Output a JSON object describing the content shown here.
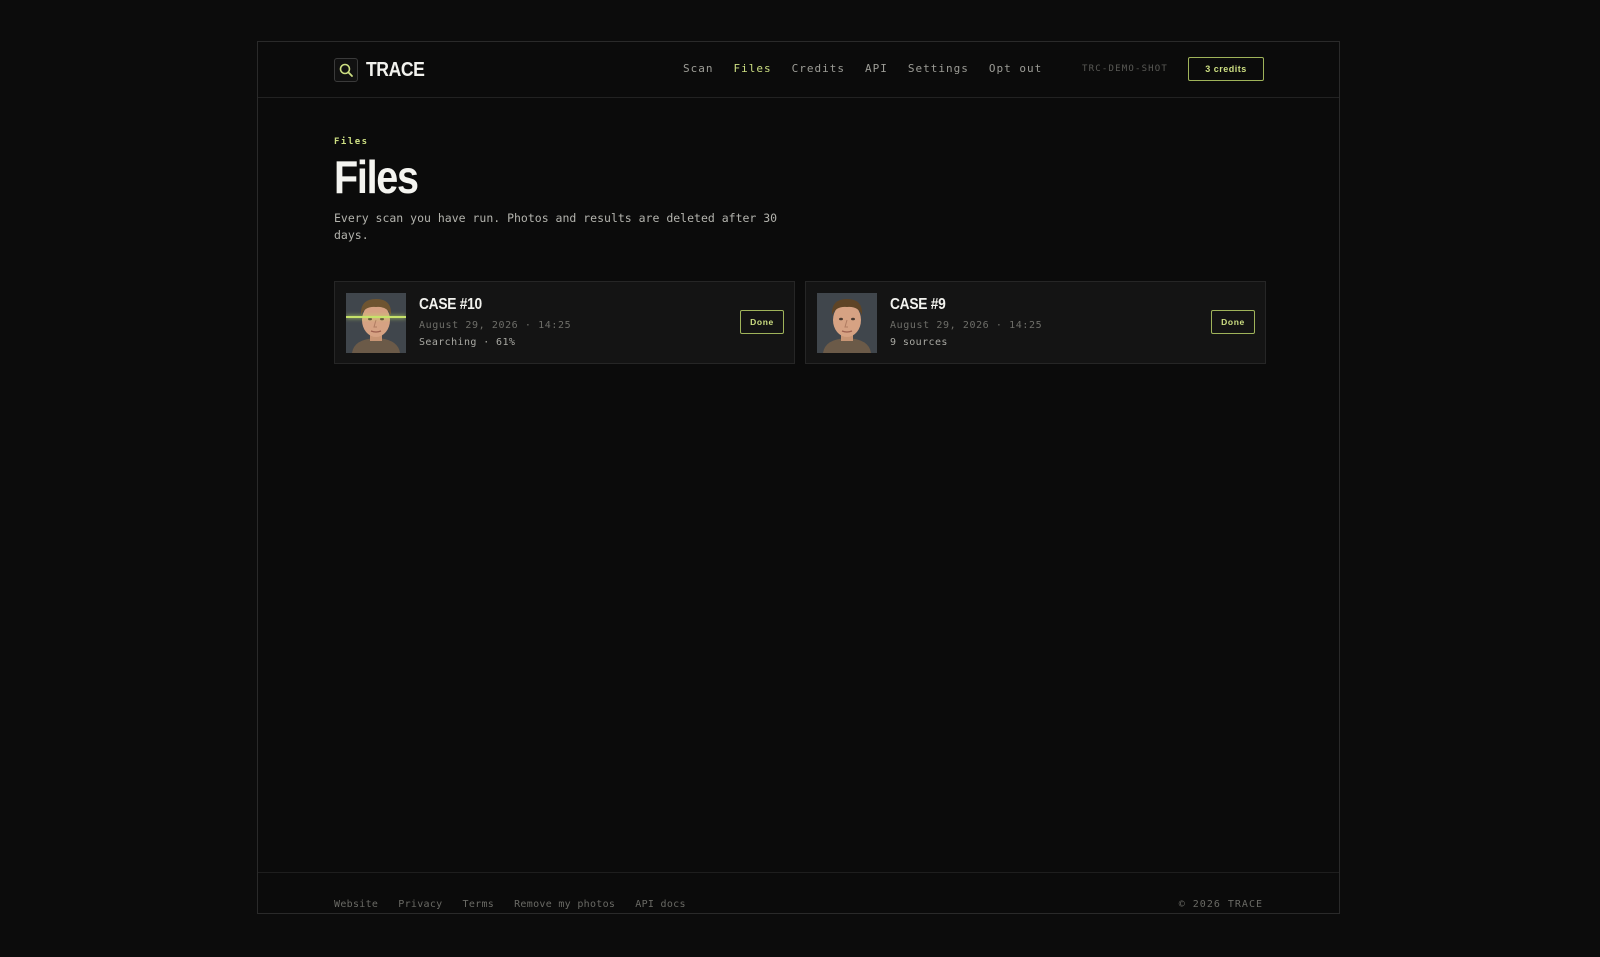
{
  "app": {
    "name": "TRACE"
  },
  "nav": {
    "items": [
      {
        "label": "Scan",
        "active": false
      },
      {
        "label": "Files",
        "active": true
      },
      {
        "label": "Credits",
        "active": false
      },
      {
        "label": "API",
        "active": false
      },
      {
        "label": "Settings",
        "active": false
      },
      {
        "label": "Opt out",
        "active": false
      }
    ],
    "account_id": "TRC-DEMO-SHOT",
    "credits_label": "3 credits"
  },
  "page": {
    "eyebrow": "Files",
    "title": "Files",
    "subtitle": "Every scan you have run. Photos and results are deleted after 30 days."
  },
  "cases": [
    {
      "title": "CASE #10",
      "date": "August 29, 2026 · 14:25",
      "status": "Searching · 61%",
      "progress": 0.61,
      "button": "Done"
    },
    {
      "title": "CASE #9",
      "date": "August 29, 2026 · 14:25",
      "status": "9 sources",
      "button": "Done"
    }
  ],
  "footer": {
    "links": [
      "Website",
      "Privacy",
      "Terms",
      "Remove my photos",
      "API docs"
    ],
    "copyright": "© 2026 TRACE"
  },
  "colors": {
    "accent": "#cddf82",
    "accent_border": "#9fb35a",
    "background": "#0b0b0b",
    "card": "#141414"
  },
  "icons": {
    "logo": "magnifier-icon"
  }
}
